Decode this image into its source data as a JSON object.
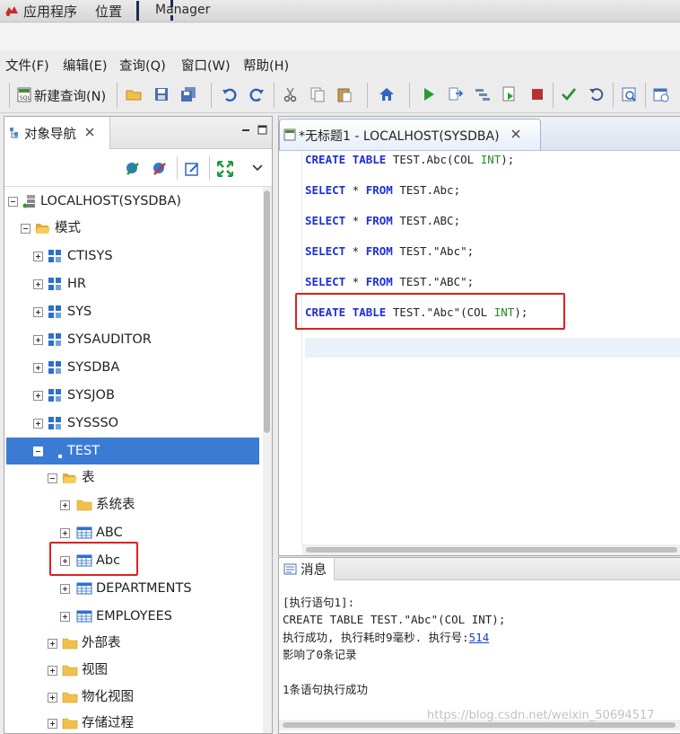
{
  "topbar": {
    "applications": "应用程序",
    "places": "位置",
    "window_title": "Manager"
  },
  "menubar": {
    "items": [
      "文件(F)",
      "编辑(E)",
      "查询(Q)",
      "窗口(W)",
      "帮助(H)"
    ]
  },
  "toolbar": {
    "new_query": "新建查询(N)"
  },
  "navigator": {
    "tab_title": "对象导航",
    "tree": [
      {
        "label": "LOCALHOST(SYSDBA)",
        "depth": 0
      },
      {
        "label": "模式",
        "depth": 1
      },
      {
        "label": "CTISYS",
        "depth": 2
      },
      {
        "label": "HR",
        "depth": 2
      },
      {
        "label": "SYS",
        "depth": 2
      },
      {
        "label": "SYSAUDITOR",
        "depth": 2
      },
      {
        "label": "SYSDBA",
        "depth": 2
      },
      {
        "label": "SYSJOB",
        "depth": 2
      },
      {
        "label": "SYSSSO",
        "depth": 2
      },
      {
        "label": "TEST",
        "depth": 2,
        "selected": true
      },
      {
        "label": "表",
        "depth": 3
      },
      {
        "label": "系统表",
        "depth": 4
      },
      {
        "label": "ABC",
        "depth": 4
      },
      {
        "label": "Abc",
        "depth": 4,
        "highlighted": true
      },
      {
        "label": "DEPARTMENTS",
        "depth": 4
      },
      {
        "label": "EMPLOYEES",
        "depth": 4
      },
      {
        "label": "外部表",
        "depth": 3
      },
      {
        "label": "视图",
        "depth": 3
      },
      {
        "label": "物化视图",
        "depth": 3
      },
      {
        "label": "存储过程",
        "depth": 3
      }
    ]
  },
  "editor": {
    "tab_title": "*无标题1 - LOCALHOST(SYSDBA)",
    "lines": [
      {
        "kw1": "CREATE",
        "kw2": "TABLE",
        "text": " TEST.Abc(COL ",
        "type": "INT",
        "tail": ");"
      },
      {
        "kw1": "SELECT",
        "mid": " * ",
        "kw2": "FROM",
        "text": " TEST.Abc;"
      },
      {
        "kw1": "SELECT",
        "mid": " * ",
        "kw2": "FROM",
        "text": " TEST.ABC;"
      },
      {
        "kw1": "SELECT",
        "mid": " * ",
        "kw2": "FROM",
        "text": " TEST.\"Abc\";"
      },
      {
        "kw1": "SELECT",
        "mid": " * ",
        "kw2": "FROM",
        "text": " TEST.\"ABC\";"
      },
      {
        "kw1": "CREATE",
        "kw2": "TABLE",
        "text": " TEST.\"Abc\"(COL ",
        "type": "INT",
        "tail": ");"
      }
    ]
  },
  "messages": {
    "tab_title": "消息",
    "line1": "[执行语句1]:",
    "line2": "CREATE TABLE TEST.\"Abc\"(COL INT);",
    "line3_prefix": "执行成功, 执行耗时9毫秒. 执行号:",
    "exec_no": "514",
    "line4": "影响了0条记录",
    "line5": "1条语句执行成功"
  },
  "watermark": "https://blog.csdn.net/weixin_50694517",
  "colors": {
    "keyword": "#1c2fd6",
    "type": "#2a8a2a",
    "selection": "#3b7bd3",
    "highlight_box": "#e02020"
  }
}
